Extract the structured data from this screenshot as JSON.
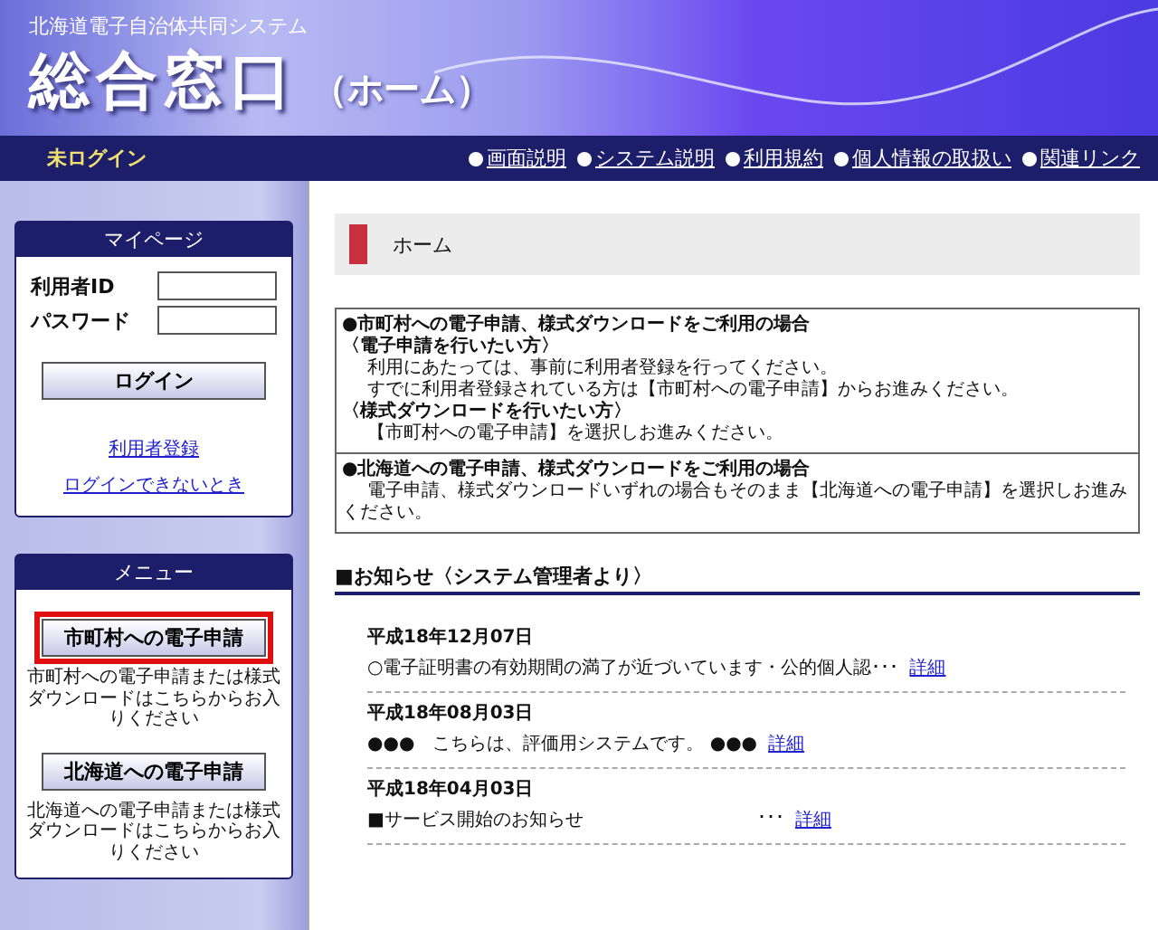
{
  "header": {
    "system_name": "北海道電子自治体共同システム",
    "title": "総合窓口",
    "subtitle": "（ホーム）"
  },
  "nav": {
    "login_status": "未ログイン",
    "links": [
      "画面説明",
      "システム説明",
      "利用規約",
      "個人情報の取扱い",
      "関連リンク"
    ]
  },
  "mypage": {
    "title": "マイページ",
    "fields": [
      {
        "label": "利用者ID"
      },
      {
        "label": "パスワード"
      }
    ],
    "login_button": "ログイン",
    "links": [
      "利用者登録",
      "ログインできないとき"
    ]
  },
  "menu": {
    "title": "メニュー",
    "items": [
      {
        "button": "市町村への電子申請",
        "description": "市町村への電子申請または様式ダウンロードはこちらからお入りください",
        "highlighted": true
      },
      {
        "button": "北海道への電子申請",
        "description": "北海道への電子申請または様式ダウンロードはこちらからお入りください",
        "highlighted": false
      }
    ]
  },
  "page_title": "ホーム",
  "info_sections": [
    {
      "heading": "●市町村への電子申請、様式ダウンロードをご利用の場合",
      "lines": [
        {
          "kind": "subheading",
          "text": "〈電子申請を行いたい方〉"
        },
        {
          "kind": "text",
          "text": "利用にあたっては、事前に利用者登録を行ってください。"
        },
        {
          "kind": "text",
          "text": "すでに利用者登録されている方は【市町村への電子申請】からお進みください。"
        },
        {
          "kind": "subheading",
          "text": "〈様式ダウンロードを行いたい方〉"
        },
        {
          "kind": "text",
          "text": "【市町村への電子申請】を選択しお進みください。"
        }
      ]
    },
    {
      "heading": "●北海道への電子申請、様式ダウンロードをご利用の場合",
      "lines": [
        {
          "kind": "paragraph",
          "text": "電子申請、様式ダウンロードいずれの場合もそのまま【北海道への電子申請】を選択しお進みください。"
        }
      ]
    }
  ],
  "notices": {
    "title": "■お知らせ〈システム管理者より〉",
    "items": [
      {
        "date": "平成18年12月07日",
        "text": "○電子証明書の有効期間の満了が近づいています・公的個人認･･･",
        "link": "詳細"
      },
      {
        "date": "平成18年08月03日",
        "text": "●●●　こちらは、評価用システムです。 ●●●",
        "link": "詳細"
      },
      {
        "date": "平成18年04月03日",
        "text": "■サービス開始のお知らせ",
        "more": "･･･",
        "link": "詳細"
      }
    ]
  }
}
